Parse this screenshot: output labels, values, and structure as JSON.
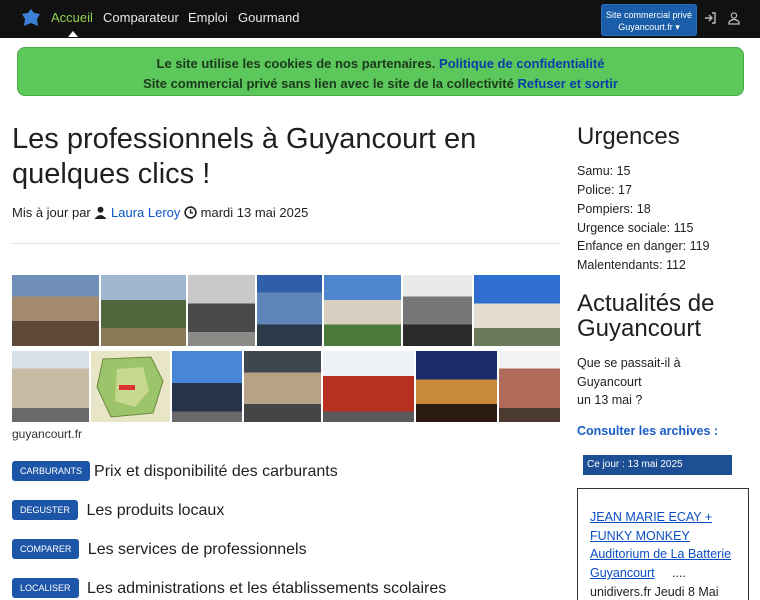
{
  "navbar": {
    "items": [
      "Accueil",
      "Comparateur",
      "Emploi",
      "Gourmand"
    ],
    "site_button_line1": "Site commercial privé",
    "site_button_line2": "Guyancourt.fr ▾",
    "icons": [
      "logo-icon",
      "login-icon",
      "user-icon"
    ],
    "active_color": "#8fd14f"
  },
  "cookie": {
    "line1_text": "Le site utilise les cookies de nos partenaires.",
    "line1_link": "Politique de confidentialité",
    "line2_text": "Site commercial privé sans lien avec le site de la collectivité",
    "line2_link": "Refuser et sortir",
    "color": "#5cc75a"
  },
  "article": {
    "title": "Les professionnels à Guyancourt en quelques clics !",
    "meta_prefix": "Mis à jour par",
    "author": "Laura Leroy",
    "date": "mardi 13 mai 2025",
    "gallery_caption": "guyancourt.fr"
  },
  "services": [
    {
      "tag": "CARBURANTS",
      "label": "Prix et disponibilité des carburants"
    },
    {
      "tag": "DEGUSTER",
      "label": "Les produits locaux"
    },
    {
      "tag": "COMPARER",
      "label": "Les services de professionnels"
    },
    {
      "tag": "LOCALISER",
      "label": "Les administrations et les établissements scolaires"
    }
  ],
  "sidebar": {
    "urgences_title": "Urgences",
    "urgences": [
      "Samu: 15",
      "Police: 17",
      "Pompiers: 18",
      "Urgence sociale: 115",
      "Enfance en danger: 119",
      "Malentendants: 112"
    ],
    "actu_title_1": "Actualités de",
    "actu_title_2": "Guyancourt",
    "question_1": "Que se passait-il à",
    "question_2": "Guyancourt",
    "question_3": "un 13 mai ?",
    "archives": "Consulter les archives :",
    "today": "Ce jour : 13 mai 2025",
    "event_1": "JEAN MARIE ECAY +",
    "event_2": "FUNKY MONKEY",
    "event_3": "Auditorium de La Batterie",
    "event_4": "Guyancourt",
    "event_dots": "....",
    "event_source": "unidivers.fr Jeudi 8 Mai"
  }
}
